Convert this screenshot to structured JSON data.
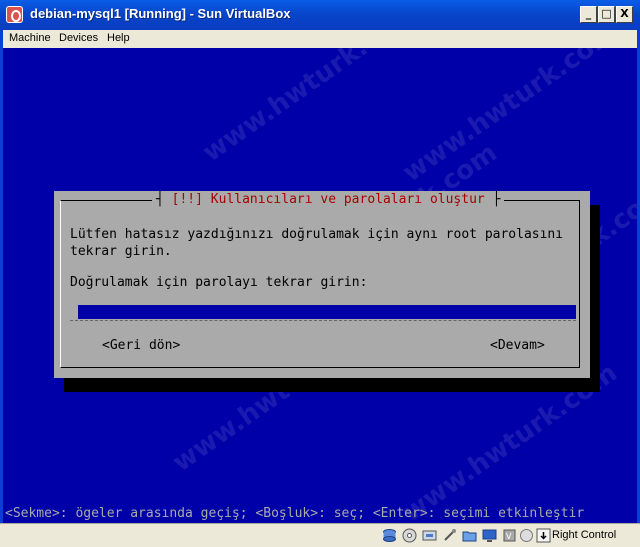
{
  "window": {
    "title": "debian-mysql1 [Running] - Sun VirtualBox",
    "controls": {
      "minimize": "_",
      "maximize": "□",
      "close": "X"
    }
  },
  "menubar": {
    "items": [
      {
        "label": "Machine"
      },
      {
        "label": "Devices"
      },
      {
        "label": "Help"
      }
    ]
  },
  "installer": {
    "dialog_title_marker": "[!!]",
    "dialog_title": "Kullanıcıları ve parolaları oluştur",
    "message_line1": "Lütfen hatasız yazdığınızı doğrulamak için aynı root parolasını",
    "message_line2": "tekrar girin.",
    "prompt": "Doğrulamak için parolayı tekrar girin:",
    "password_value": "",
    "back_button": "<Geri dön>",
    "continue_button": "<Devam>",
    "help_line": "<Sekme>: ögeler arasında geçiş; <Boşluk>: seç; <Enter>: seçimi etkinleştir"
  },
  "statusbar": {
    "icons": [
      "hard-disk-icon",
      "cd-icon",
      "network-icon",
      "usb-icon",
      "shared-folder-icon",
      "display-icon",
      "virtualization-icon",
      "mouse-integration-icon"
    ],
    "host_key": "Right Control"
  },
  "colors": {
    "installer_background": "#0000a8",
    "dialog_background": "#aaaaaa",
    "title_text": "#a80000",
    "titlebar": "#0a4fd6"
  },
  "watermark": "www.hwturk.com"
}
